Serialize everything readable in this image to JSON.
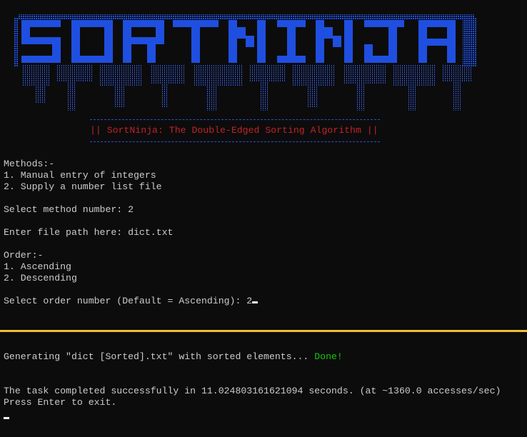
{
  "banner": {
    "logo_text": "SORTNINJA",
    "subtitle": "|| SortNinja: The Double-Edged Sorting Algorithm ||",
    "colors": {
      "logo": "#1f4fe0",
      "shadow": "#3a5fd8",
      "subtitle": "#c0222b",
      "separator": "#2b4fd1"
    }
  },
  "session1": {
    "methods_header": "Methods:-",
    "method_1": "1. Manual entry of integers",
    "method_2": "2. Supply a number list file",
    "select_method_prompt": "Select method number: ",
    "select_method_value": "2",
    "file_path_prompt": "Enter file path here: ",
    "file_path_value": "dict.txt",
    "order_header": "Order:-",
    "order_1": "1. Ascending",
    "order_2": "2. Descending",
    "select_order_prompt": "Select order number (Default = Ascending): ",
    "select_order_value": "2"
  },
  "divider_color": "#f1be34",
  "session2": {
    "generating_text": "Generating \"dict [Sorted].txt\" with sorted elements... ",
    "done_text": "Done!",
    "done_color": "#16c60c",
    "completed_text": "The task completed successfully in 11.024803161621094 seconds. (at ~1360.0 accesses/sec)",
    "exit_text": "Press Enter to exit."
  }
}
